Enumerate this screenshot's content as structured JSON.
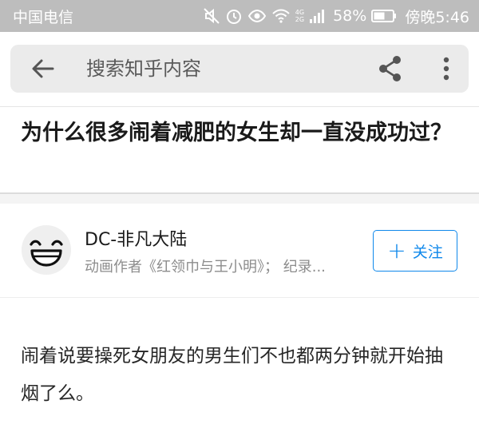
{
  "status_bar": {
    "carrier": "中国电信",
    "battery_percent": "58%",
    "time": "傍晚5:46",
    "network_label_top": "4G",
    "network_label_bottom": "2G",
    "icons": [
      "mute-icon",
      "alarm-icon",
      "eye-icon",
      "wifi-icon",
      "signal-icon",
      "battery-icon"
    ]
  },
  "header": {
    "search_placeholder": "搜索知乎内容",
    "icons": [
      "back-arrow-icon",
      "share-icon",
      "more-vertical-icon"
    ]
  },
  "question": {
    "title": "为什么很多闹着减肥的女生却一直没成功过？"
  },
  "author": {
    "name": "DC-非凡大陆",
    "bio": "动画作者《红领巾与王小明》； 纪录...",
    "follow_label": "关注",
    "avatar_icon": "laughing-face-avatar"
  },
  "answer": {
    "text": "闹着说要操死女朋友的男生们不也都两分钟就开始抽烟了么。"
  },
  "colors": {
    "status_bar_bg": "#bdbdbd",
    "accent": "#0f88eb",
    "search_bg": "#ebebeb"
  }
}
